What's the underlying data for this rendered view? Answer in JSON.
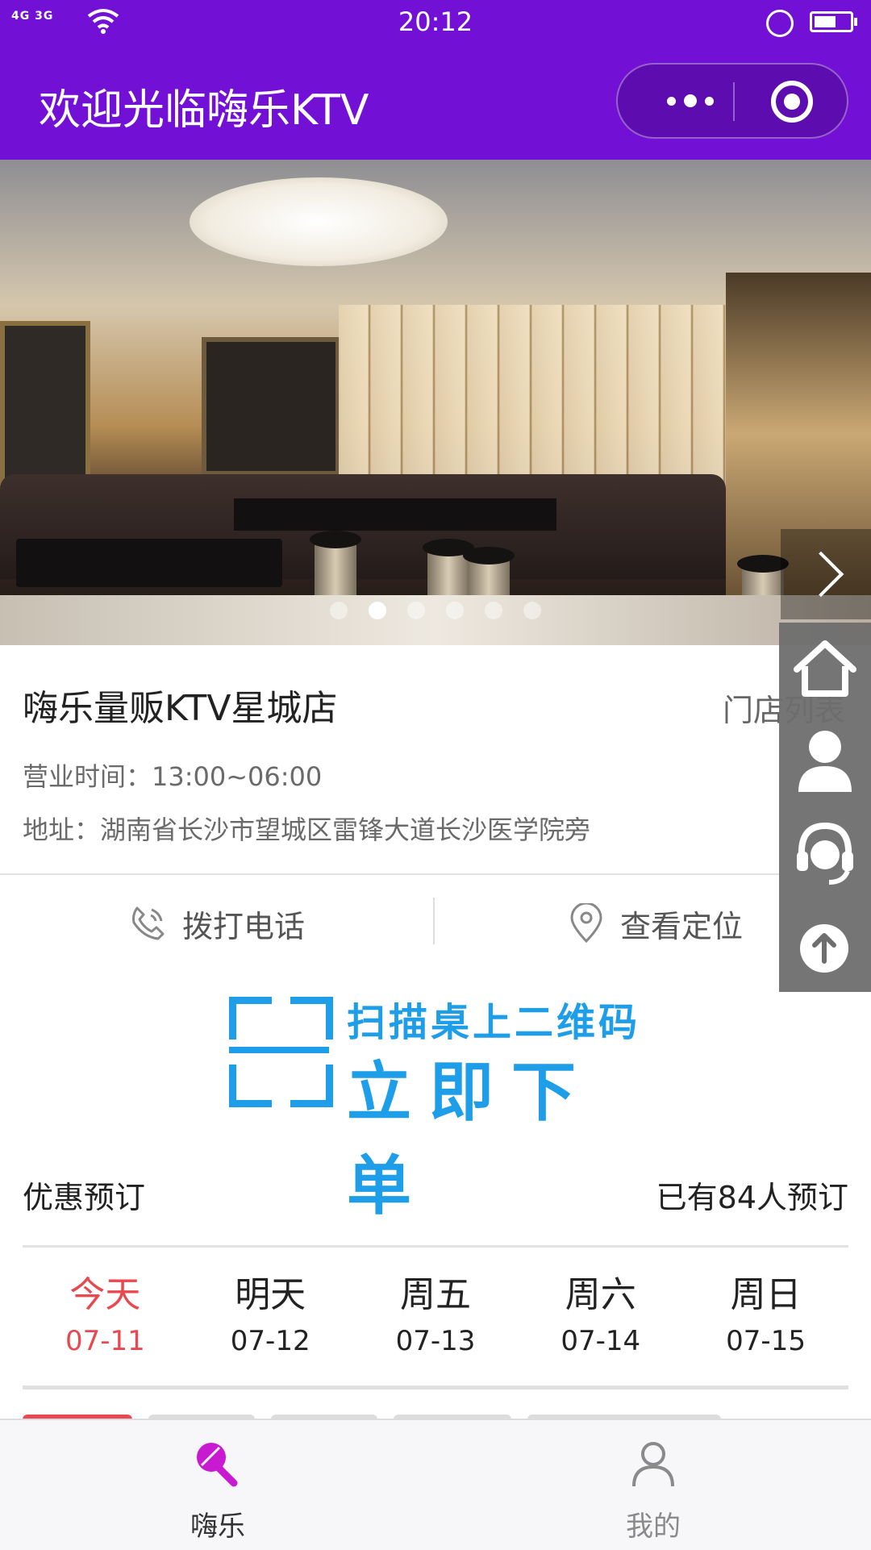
{
  "status_bar": {
    "signal": "4G 3G",
    "time": "20:12",
    "icons": [
      "signal-icon",
      "wifi-icon",
      "lock-rotation-icon",
      "battery-icon"
    ]
  },
  "nav": {
    "title": "欢迎光临嗨乐KTV",
    "menu_icon": "more-dots-icon",
    "close_icon": "target-icon"
  },
  "banner": {
    "slide_count": 6,
    "active_slide": 2,
    "next_icon": "chevron-right-icon"
  },
  "shop": {
    "name": "嗨乐量贩KTV星城店",
    "store_list": "门店列表",
    "hours": "营业时间：13:00~06:00",
    "address": "地址：湖南省长沙市望城区雷锋大道长沙医学院旁"
  },
  "actions": {
    "call": "拨打电话",
    "locate": "查看定位"
  },
  "scan": {
    "line1": "扫描桌上二维码",
    "line2": "立即下单"
  },
  "booking": {
    "title": "优惠预订",
    "count": "已有84人预订",
    "days": [
      {
        "weekday": "今天",
        "date": "07-11"
      },
      {
        "weekday": "明天",
        "date": "07-12"
      },
      {
        "weekday": "周五",
        "date": "07-13"
      },
      {
        "weekday": "周六",
        "date": "07-14"
      },
      {
        "weekday": "周日",
        "date": "07-15"
      }
    ]
  },
  "side_menu": [
    "home-icon",
    "user-icon",
    "customer-service-icon",
    "back-to-top-icon"
  ],
  "tabbar": {
    "items": [
      {
        "label": "嗨乐",
        "icon": "microphone-icon",
        "active": true
      },
      {
        "label": "我的",
        "icon": "person-icon",
        "active": false
      }
    ]
  },
  "colors": {
    "primary": "#7210d6",
    "accent_red": "#e8484f",
    "scan_blue": "#1e9de8",
    "tab_active": "#c81ad1"
  }
}
